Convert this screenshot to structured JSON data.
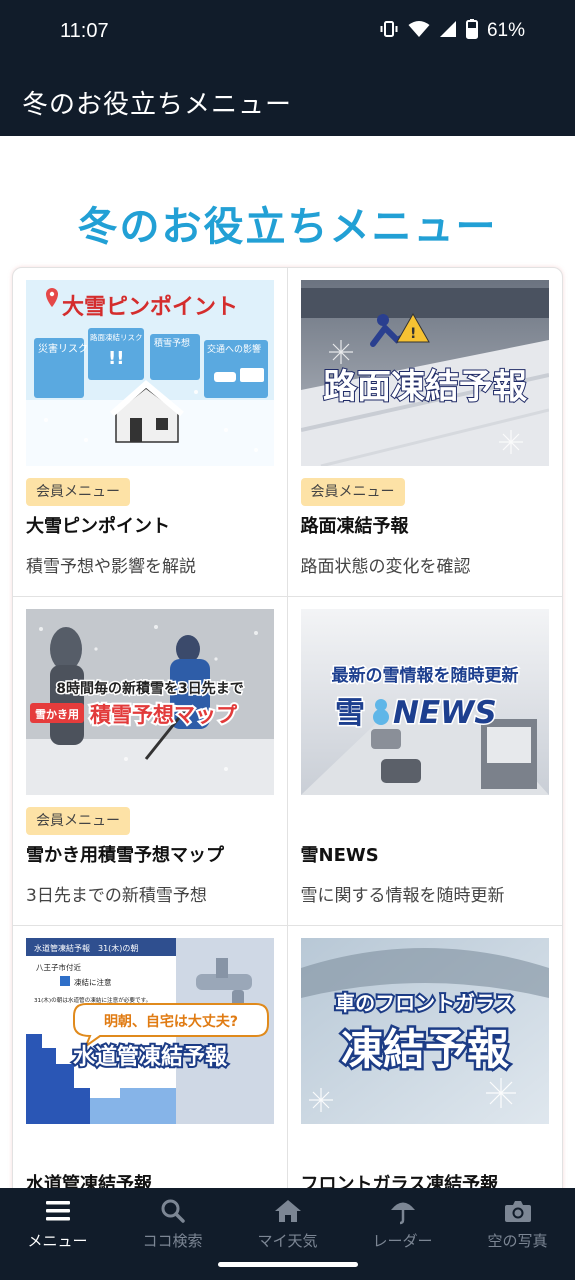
{
  "status_bar": {
    "time": "11:07",
    "battery": "61%",
    "icons": [
      "vibrate-icon",
      "wifi-icon",
      "signal-icon",
      "battery-icon"
    ]
  },
  "app_bar": {
    "title": "冬のお役立ちメニュー"
  },
  "page": {
    "heading": "冬のお役立ちメニュー"
  },
  "cards": [
    {
      "badge": "会員メニュー",
      "title": "大雪ピンポイント",
      "desc": "積雪予想や影響を解説",
      "img_text": {
        "header": "大雪ピンポイント",
        "tag1": "災害リスク",
        "tag2": "路面凍結リスク",
        "tag3": "積雪予想",
        "tag4": "交通への影響"
      }
    },
    {
      "badge": "会員メニュー",
      "title": "路面凍結予報",
      "desc": "路面状態の変化を確認",
      "img_text": {
        "main": "路面凍結予報"
      }
    },
    {
      "badge": "会員メニュー",
      "title": "雪かき用積雪予想マップ",
      "desc": "3日先までの新積雪予想",
      "img_text": {
        "line1": "8時間毎の新積雪を3日先まで",
        "tag": "雪かき用",
        "main": "積雪予想マップ"
      }
    },
    {
      "badge": "",
      "title": "雪NEWS",
      "desc": "雪に関する情報を随時更新",
      "img_text": {
        "line1": "最新の雪情報を随時更新",
        "logo_snow": "雪",
        "logo_news": "NEWS"
      }
    },
    {
      "badge": "",
      "title": "水道管凍結予報",
      "desc": "",
      "img_text": {
        "header": "水道管凍結予報　31(木)の朝",
        "place": "八王子市付近",
        "caution": "凍結に注意",
        "note": "31(木)の朝は水道管の凍結に注意が必要です。",
        "bubble": "明朝、自宅は大丈夫?",
        "main": "水道管凍結予報"
      }
    },
    {
      "badge": "",
      "title": "フロントガラス凍結予報",
      "desc": "",
      "img_text": {
        "line1": "車のフロントガラス",
        "main": "凍結予報"
      }
    }
  ],
  "bottom_nav": [
    {
      "label": "メニュー",
      "icon": "menu-icon",
      "active": true
    },
    {
      "label": "ココ検索",
      "icon": "search-icon",
      "active": false
    },
    {
      "label": "マイ天気",
      "icon": "home-icon",
      "active": false
    },
    {
      "label": "レーダー",
      "icon": "umbrella-icon",
      "active": false
    },
    {
      "label": "空の写真",
      "icon": "camera-icon",
      "active": false
    }
  ]
}
